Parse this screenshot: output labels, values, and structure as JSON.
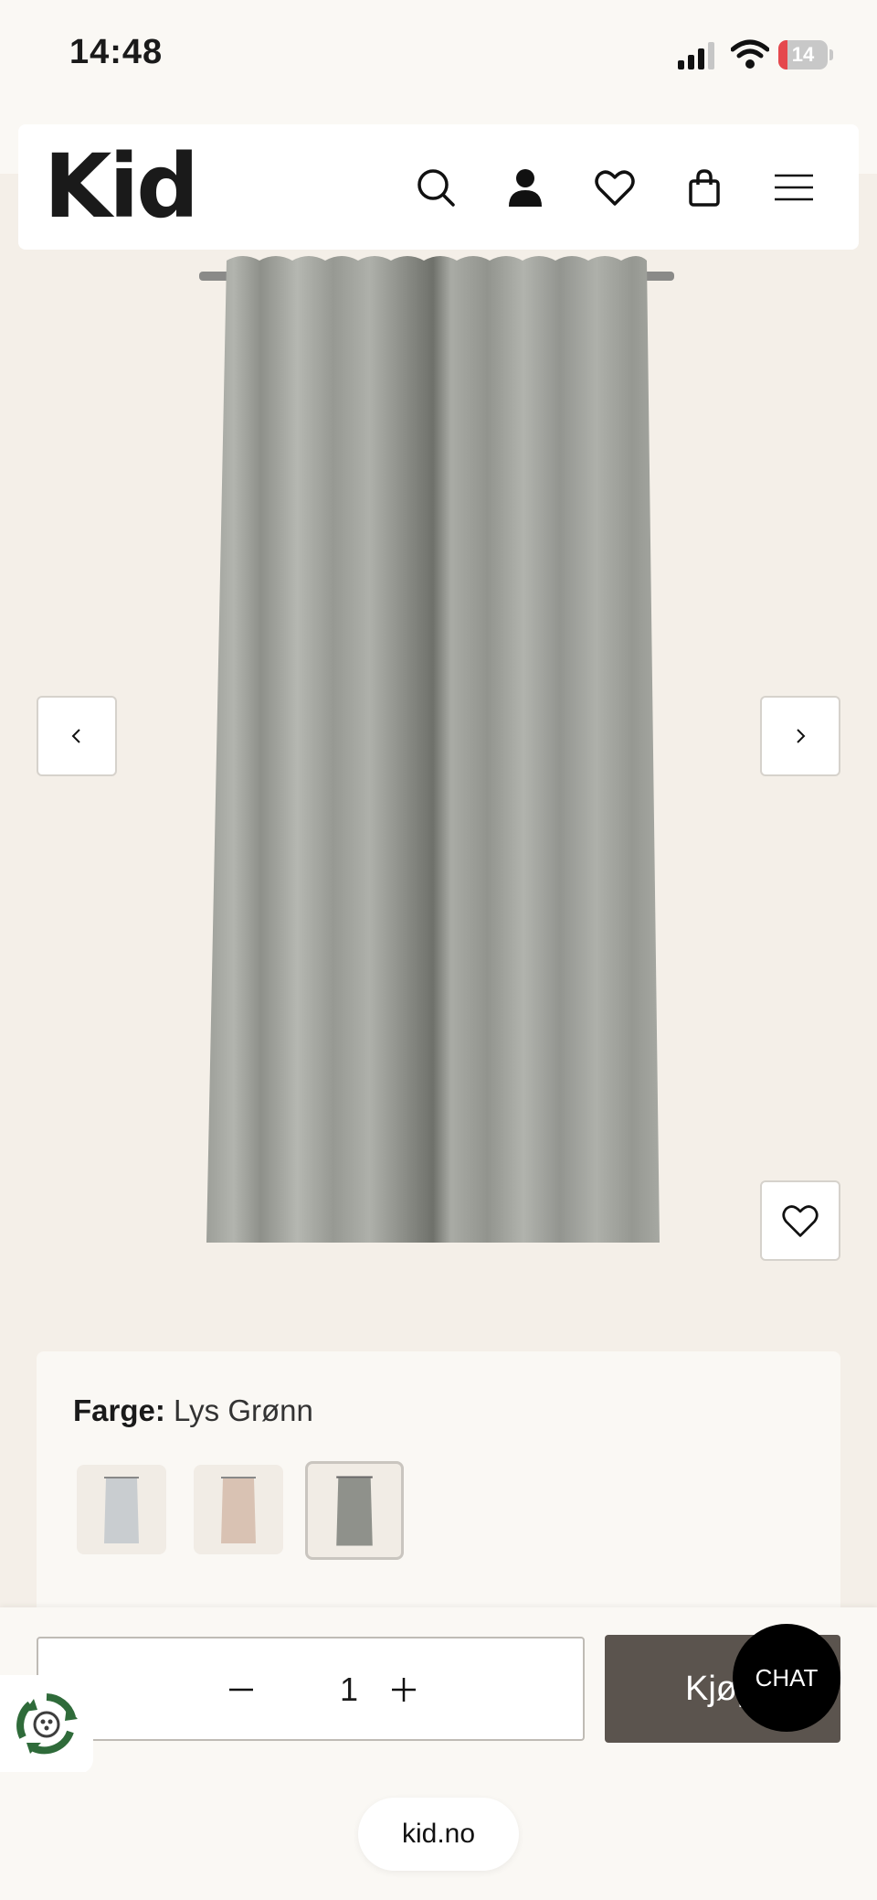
{
  "status_bar": {
    "time": "14:48",
    "battery_text": "14",
    "battery_level": 0.14,
    "battery_color": "#e5484d"
  },
  "header": {
    "logo": "Kid",
    "icons": [
      "search-icon",
      "account-icon",
      "wishlist-icon",
      "cart-icon",
      "menu-icon"
    ]
  },
  "gallery": {
    "prev_icon": "chevron-left-icon",
    "next_icon": "chevron-right-icon",
    "favorite_icon": "heart-icon"
  },
  "product": {
    "color_label": "Farge:",
    "color_value": "Lys Grønn",
    "swatches": [
      {
        "color": "#c9cdd0",
        "selected": false
      },
      {
        "color": "#d9c2b3",
        "selected": false
      },
      {
        "color": "#8f918b",
        "selected": true
      }
    ]
  },
  "purchase": {
    "quantity": "1",
    "buy_label": "Kjøp",
    "chat_label": "CHAT"
  },
  "browser": {
    "url": "kid.no"
  },
  "colors": {
    "background": "#f4efe8",
    "buy_button": "#5b544e",
    "eco_green": "#2f6b3a"
  }
}
